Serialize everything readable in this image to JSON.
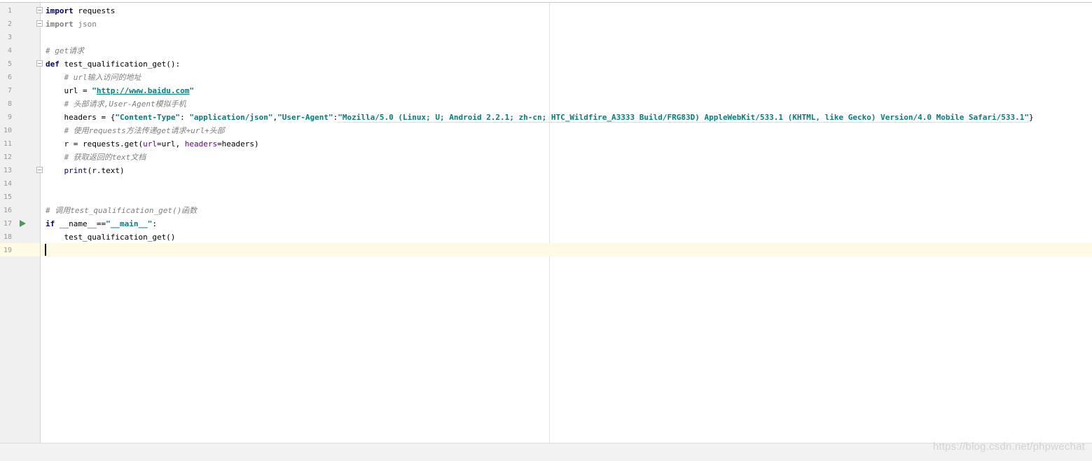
{
  "editor": {
    "lines": [
      {
        "num": "1",
        "parts": [
          {
            "t": "import",
            "c": "kw"
          },
          {
            "t": " requests",
            "c": ""
          }
        ]
      },
      {
        "num": "2",
        "parts": [
          {
            "t": "import",
            "c": "kwgray"
          },
          {
            "t": " json",
            "c": "gray"
          }
        ]
      },
      {
        "num": "3",
        "parts": []
      },
      {
        "num": "4",
        "parts": [
          {
            "t": "# get请求",
            "c": "cm"
          }
        ]
      },
      {
        "num": "5",
        "parts": [
          {
            "t": "def",
            "c": "kw"
          },
          {
            "t": " test_qualification_get():",
            "c": ""
          }
        ]
      },
      {
        "num": "6",
        "parts": [
          {
            "t": "    ",
            "c": ""
          },
          {
            "t": "# url输入访问的地址",
            "c": "cm"
          }
        ]
      },
      {
        "num": "7",
        "parts": [
          {
            "t": "    url = ",
            "c": ""
          },
          {
            "t": "\"",
            "c": "str"
          },
          {
            "t": "http://www.baidu.com",
            "c": "link"
          },
          {
            "t": "\"",
            "c": "str"
          }
        ]
      },
      {
        "num": "8",
        "parts": [
          {
            "t": "    ",
            "c": ""
          },
          {
            "t": "# 头部请求,User-Agent模拟手机",
            "c": "cm"
          }
        ]
      },
      {
        "num": "9",
        "parts": [
          {
            "t": "    headers = {",
            "c": ""
          },
          {
            "t": "\"Content-Type\"",
            "c": "str"
          },
          {
            "t": ": ",
            "c": ""
          },
          {
            "t": "\"application/json\"",
            "c": "str"
          },
          {
            "t": ",",
            "c": ""
          },
          {
            "t": "\"User-Agent\"",
            "c": "str"
          },
          {
            "t": ":",
            "c": ""
          },
          {
            "t": "\"Mozilla/5.0 (Linux; U; Android 2.2.1; zh-cn; HTC_Wildfire_A3333 Build/FRG83D) AppleWebKit/533.1 (KHTML, like Gecko) Version/4.0 Mobile Safari/533.1\"",
            "c": "str under"
          },
          {
            "t": "}",
            "c": ""
          }
        ]
      },
      {
        "num": "10",
        "parts": [
          {
            "t": "    ",
            "c": ""
          },
          {
            "t": "# 使用requests方法传递get请求+url+头部",
            "c": "cm"
          }
        ]
      },
      {
        "num": "11",
        "parts": [
          {
            "t": "    r = requests.get(",
            "c": ""
          },
          {
            "t": "url",
            "c": "param"
          },
          {
            "t": "=url, ",
            "c": ""
          },
          {
            "t": "headers",
            "c": "param"
          },
          {
            "t": "=headers)",
            "c": ""
          }
        ]
      },
      {
        "num": "12",
        "parts": [
          {
            "t": "    ",
            "c": ""
          },
          {
            "t": "# 获取返回的text文档",
            "c": "cm"
          }
        ]
      },
      {
        "num": "13",
        "parts": [
          {
            "t": "    ",
            "c": ""
          },
          {
            "t": "print",
            "c": "bi"
          },
          {
            "t": "(r.text)",
            "c": ""
          }
        ]
      },
      {
        "num": "14",
        "parts": []
      },
      {
        "num": "15",
        "parts": []
      },
      {
        "num": "16",
        "parts": [
          {
            "t": "# 调用test_qualification_get()函数",
            "c": "cm"
          }
        ]
      },
      {
        "num": "17",
        "parts": [
          {
            "t": "if",
            "c": "kw"
          },
          {
            "t": " __name__==",
            "c": ""
          },
          {
            "t": "\"__main__\"",
            "c": "str"
          },
          {
            "t": ":",
            "c": ""
          }
        ]
      },
      {
        "num": "18",
        "parts": [
          {
            "t": "    test_qualification_get()",
            "c": ""
          }
        ]
      },
      {
        "num": "19",
        "parts": []
      }
    ]
  },
  "watermark": "https://blog.csdn.net/phpwechat",
  "icons": {
    "fold": "fold-marker-icon",
    "run": "run-arrow-icon"
  },
  "colors": {
    "keyword": "#000080",
    "string": "#008080",
    "comment": "#808080",
    "param": "#660099",
    "current_line": "#fffae3",
    "run": "#499c54"
  }
}
